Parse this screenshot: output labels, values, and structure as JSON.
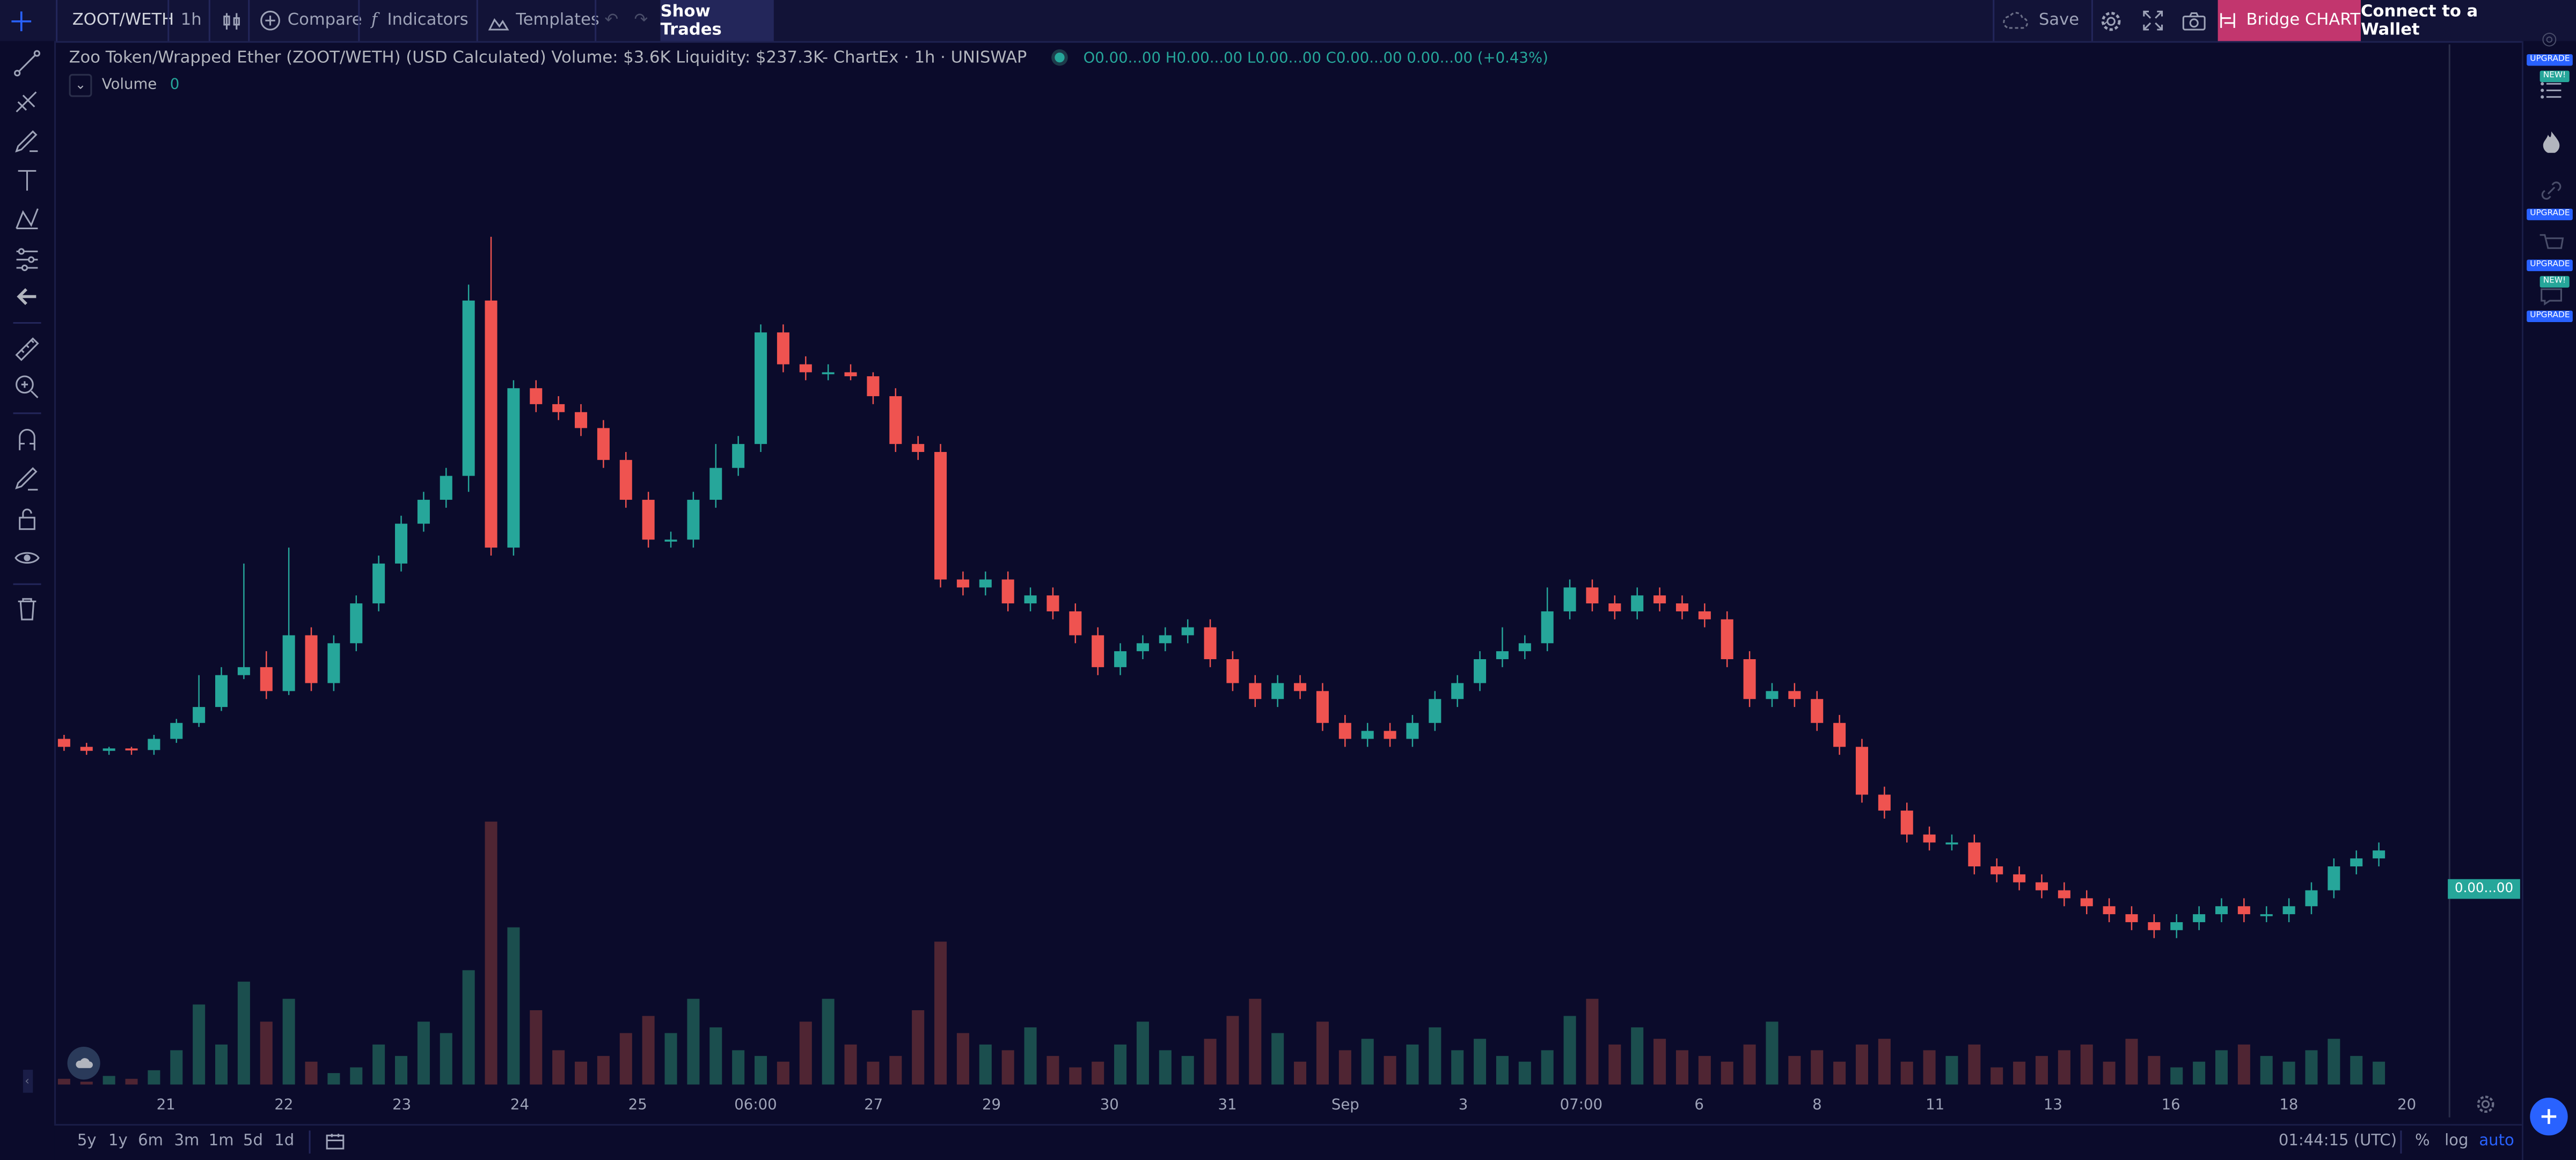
{
  "topbar": {
    "symbol": "ZOOT/WETH",
    "interval": "1h",
    "compare_label": "Compare",
    "indicators_label": "Indicators",
    "templates_label": "Templates",
    "show_trades_label": "Show Trades",
    "save_label": "Save",
    "bridge_label": "Bridge CHART",
    "connect_label": "Connect to a Wallet",
    "bridge_color": "#c2366e"
  },
  "legend": {
    "title": "Zoo Token/Wrapped Ether (ZOOT/WETH) (USD Calculated) Volume: $3.6K Liquidity: $237.3K- ChartEx · 1h · UNISWAP",
    "ohlc": "O0.00...00  H0.00...00  L0.00...00  C0.00...00  0.00...00 (+0.43%)",
    "volume_label": "Volume",
    "volume_value": "0"
  },
  "price_badge": "0.00...00",
  "time_labels": [
    "21",
    "22",
    "23",
    "24",
    "25",
    "06:00",
    "27",
    "29",
    "30",
    "31",
    "Sep",
    "3",
    "07:00",
    "6",
    "8",
    "11",
    "13",
    "16",
    "18",
    "20"
  ],
  "bottombar": {
    "ranges": [
      "5y",
      "1y",
      "6m",
      "3m",
      "1m",
      "5d",
      "1d"
    ],
    "clock": "01:44:15 (UTC)",
    "pct_label": "%",
    "log_label": "log",
    "auto_label": "auto"
  },
  "right_badges": [
    "UPGRADE",
    "NEW!",
    "UPGRADE",
    "UPGRADE",
    "NEW!",
    "UPGRADE"
  ],
  "colors": {
    "up": "#26a69a",
    "down": "#ef5350",
    "bg": "#0b0b2b"
  },
  "chart_data": {
    "type": "candlestick",
    "candles": [
      [
        0,
        0.31,
        0.3,
        0.315,
        0.295
      ],
      [
        1,
        0.3,
        0.295,
        0.305,
        0.29
      ],
      [
        2,
        0.295,
        0.298,
        0.3,
        0.29
      ],
      [
        3,
        0.298,
        0.296,
        0.3,
        0.29
      ],
      [
        4,
        0.296,
        0.31,
        0.315,
        0.29
      ],
      [
        5,
        0.31,
        0.33,
        0.335,
        0.305
      ],
      [
        6,
        0.33,
        0.35,
        0.39,
        0.325
      ],
      [
        7,
        0.35,
        0.39,
        0.4,
        0.345
      ],
      [
        8,
        0.39,
        0.4,
        0.53,
        0.385
      ],
      [
        9,
        0.4,
        0.37,
        0.42,
        0.36
      ],
      [
        10,
        0.37,
        0.44,
        0.55,
        0.365
      ],
      [
        11,
        0.44,
        0.38,
        0.45,
        0.37
      ],
      [
        12,
        0.38,
        0.43,
        0.44,
        0.37
      ],
      [
        13,
        0.43,
        0.48,
        0.49,
        0.42
      ],
      [
        14,
        0.48,
        0.53,
        0.54,
        0.47
      ],
      [
        15,
        0.53,
        0.58,
        0.59,
        0.52
      ],
      [
        16,
        0.58,
        0.61,
        0.62,
        0.57
      ],
      [
        17,
        0.61,
        0.64,
        0.65,
        0.6
      ],
      [
        18,
        0.64,
        0.86,
        0.88,
        0.62
      ],
      [
        19,
        0.86,
        0.55,
        0.94,
        0.54
      ],
      [
        20,
        0.55,
        0.75,
        0.76,
        0.54
      ],
      [
        21,
        0.75,
        0.73,
        0.76,
        0.72
      ],
      [
        22,
        0.73,
        0.72,
        0.74,
        0.71
      ],
      [
        23,
        0.72,
        0.7,
        0.73,
        0.69
      ],
      [
        24,
        0.7,
        0.66,
        0.71,
        0.65
      ],
      [
        25,
        0.66,
        0.61,
        0.67,
        0.6
      ],
      [
        26,
        0.61,
        0.56,
        0.62,
        0.55
      ],
      [
        27,
        0.56,
        0.56,
        0.57,
        0.55
      ],
      [
        28,
        0.56,
        0.61,
        0.62,
        0.55
      ],
      [
        29,
        0.61,
        0.65,
        0.68,
        0.6
      ],
      [
        30,
        0.65,
        0.68,
        0.69,
        0.64
      ],
      [
        31,
        0.68,
        0.82,
        0.83,
        0.67
      ],
      [
        32,
        0.82,
        0.78,
        0.83,
        0.77
      ],
      [
        33,
        0.78,
        0.77,
        0.79,
        0.76
      ],
      [
        34,
        0.77,
        0.77,
        0.78,
        0.76
      ],
      [
        35,
        0.77,
        0.765,
        0.78,
        0.76
      ],
      [
        36,
        0.765,
        0.74,
        0.77,
        0.73
      ],
      [
        37,
        0.74,
        0.68,
        0.75,
        0.67
      ],
      [
        38,
        0.68,
        0.67,
        0.69,
        0.66
      ],
      [
        39,
        0.67,
        0.51,
        0.68,
        0.5
      ],
      [
        40,
        0.51,
        0.5,
        0.52,
        0.49
      ],
      [
        41,
        0.5,
        0.51,
        0.52,
        0.49
      ],
      [
        42,
        0.51,
        0.48,
        0.52,
        0.47
      ],
      [
        43,
        0.48,
        0.49,
        0.5,
        0.47
      ],
      [
        44,
        0.49,
        0.47,
        0.5,
        0.46
      ],
      [
        45,
        0.47,
        0.44,
        0.48,
        0.43
      ],
      [
        46,
        0.44,
        0.4,
        0.45,
        0.39
      ],
      [
        47,
        0.4,
        0.42,
        0.43,
        0.39
      ],
      [
        48,
        0.42,
        0.43,
        0.44,
        0.41
      ],
      [
        49,
        0.43,
        0.44,
        0.45,
        0.42
      ],
      [
        50,
        0.44,
        0.45,
        0.46,
        0.43
      ],
      [
        51,
        0.45,
        0.41,
        0.46,
        0.4
      ],
      [
        52,
        0.41,
        0.38,
        0.42,
        0.37
      ],
      [
        53,
        0.38,
        0.36,
        0.39,
        0.35
      ],
      [
        54,
        0.36,
        0.38,
        0.39,
        0.35
      ],
      [
        55,
        0.38,
        0.37,
        0.39,
        0.36
      ],
      [
        56,
        0.37,
        0.33,
        0.38,
        0.32
      ],
      [
        57,
        0.33,
        0.31,
        0.34,
        0.3
      ],
      [
        58,
        0.31,
        0.32,
        0.33,
        0.3
      ],
      [
        59,
        0.32,
        0.31,
        0.33,
        0.3
      ],
      [
        60,
        0.31,
        0.33,
        0.34,
        0.3
      ],
      [
        61,
        0.33,
        0.36,
        0.37,
        0.32
      ],
      [
        62,
        0.36,
        0.38,
        0.39,
        0.35
      ],
      [
        63,
        0.38,
        0.41,
        0.42,
        0.37
      ],
      [
        64,
        0.41,
        0.42,
        0.45,
        0.4
      ],
      [
        65,
        0.42,
        0.43,
        0.44,
        0.41
      ],
      [
        66,
        0.43,
        0.47,
        0.5,
        0.42
      ],
      [
        67,
        0.47,
        0.5,
        0.51,
        0.46
      ],
      [
        68,
        0.5,
        0.48,
        0.51,
        0.47
      ],
      [
        69,
        0.48,
        0.47,
        0.49,
        0.46
      ],
      [
        70,
        0.47,
        0.49,
        0.5,
        0.46
      ],
      [
        71,
        0.49,
        0.48,
        0.5,
        0.47
      ],
      [
        72,
        0.48,
        0.47,
        0.49,
        0.46
      ],
      [
        73,
        0.47,
        0.46,
        0.48,
        0.45
      ],
      [
        74,
        0.46,
        0.41,
        0.47,
        0.4
      ],
      [
        75,
        0.41,
        0.36,
        0.42,
        0.35
      ],
      [
        76,
        0.36,
        0.37,
        0.38,
        0.35
      ],
      [
        77,
        0.37,
        0.36,
        0.38,
        0.35
      ],
      [
        78,
        0.36,
        0.33,
        0.37,
        0.32
      ],
      [
        79,
        0.33,
        0.3,
        0.34,
        0.29
      ],
      [
        80,
        0.3,
        0.24,
        0.31,
        0.23
      ],
      [
        81,
        0.24,
        0.22,
        0.25,
        0.21
      ],
      [
        82,
        0.22,
        0.19,
        0.23,
        0.18
      ],
      [
        83,
        0.19,
        0.18,
        0.2,
        0.17
      ],
      [
        84,
        0.18,
        0.18,
        0.19,
        0.17
      ],
      [
        85,
        0.18,
        0.15,
        0.19,
        0.14
      ],
      [
        86,
        0.15,
        0.14,
        0.16,
        0.13
      ],
      [
        87,
        0.14,
        0.13,
        0.15,
        0.12
      ],
      [
        88,
        0.13,
        0.12,
        0.14,
        0.11
      ],
      [
        89,
        0.12,
        0.11,
        0.13,
        0.1
      ],
      [
        90,
        0.11,
        0.1,
        0.12,
        0.09
      ],
      [
        91,
        0.1,
        0.09,
        0.11,
        0.08
      ],
      [
        92,
        0.09,
        0.08,
        0.1,
        0.07
      ],
      [
        93,
        0.08,
        0.07,
        0.09,
        0.06
      ],
      [
        94,
        0.07,
        0.08,
        0.09,
        0.06
      ],
      [
        95,
        0.08,
        0.09,
        0.1,
        0.07
      ],
      [
        96,
        0.09,
        0.1,
        0.11,
        0.08
      ],
      [
        97,
        0.1,
        0.09,
        0.11,
        0.08
      ],
      [
        98,
        0.09,
        0.09,
        0.1,
        0.08
      ],
      [
        99,
        0.09,
        0.1,
        0.11,
        0.08
      ],
      [
        100,
        0.1,
        0.12,
        0.13,
        0.09
      ],
      [
        101,
        0.12,
        0.15,
        0.16,
        0.11
      ],
      [
        102,
        0.15,
        0.16,
        0.17,
        0.14
      ],
      [
        103,
        0.16,
        0.17,
        0.18,
        0.15
      ]
    ],
    "volume": [
      2,
      1,
      3,
      2,
      5,
      12,
      28,
      14,
      36,
      22,
      30,
      8,
      4,
      6,
      14,
      10,
      22,
      18,
      40,
      92,
      55,
      26,
      12,
      8,
      10,
      18,
      24,
      18,
      30,
      20,
      12,
      10,
      8,
      22,
      30,
      14,
      8,
      10,
      26,
      50,
      18,
      14,
      12,
      20,
      10,
      6,
      8,
      14,
      22,
      12,
      10,
      16,
      24,
      30,
      18,
      8,
      22,
      12,
      16,
      10,
      14,
      20,
      12,
      16,
      10,
      8,
      12,
      24,
      30,
      14,
      20,
      16,
      12,
      10,
      8,
      14,
      22,
      10,
      12,
      8,
      14,
      16,
      8,
      12,
      10,
      14,
      6,
      8,
      10,
      12,
      14,
      8,
      16,
      10,
      6,
      8,
      12,
      14,
      10,
      8,
      12,
      16,
      10,
      8
    ],
    "price_label": "0.00...00",
    "time_labels": [
      "21",
      "22",
      "23",
      "24",
      "25",
      "06:00",
      "27",
      "29",
      "30",
      "31",
      "Sep",
      "3",
      "07:00",
      "6",
      "8",
      "11",
      "13",
      "16",
      "18",
      "20"
    ],
    "y_axis": "hidden",
    "grid": false
  }
}
